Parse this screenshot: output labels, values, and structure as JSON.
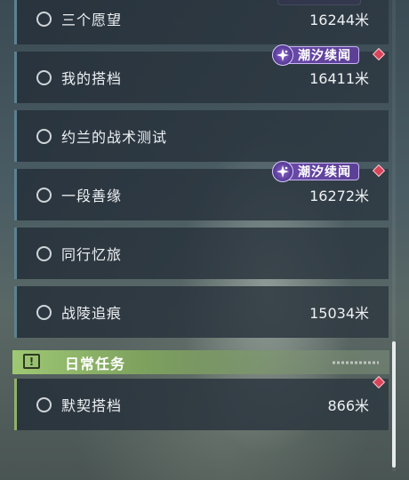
{
  "quests": [
    {
      "title": "三个愿望",
      "distance": "16244米"
    },
    {
      "title": "我的搭档",
      "distance": "16411米"
    },
    {
      "title": "约兰的战术测试",
      "distance": ""
    },
    {
      "title": "一段善缘",
      "distance": "16272米"
    },
    {
      "title": "同行忆旅",
      "distance": ""
    },
    {
      "title": "战陵追痕",
      "distance": "15034米"
    }
  ],
  "badges": [
    {
      "label": "潮汐续闻",
      "icon": "sparkle-icon",
      "color": "#6a4aa8"
    },
    {
      "label": "潮汐续闻",
      "icon": "sparkle-icon",
      "color": "#6a4aa8"
    }
  ],
  "daily_section": {
    "title": "日常任务",
    "icon": "exclamation-icon",
    "color": "#9fc874"
  },
  "daily_quests": [
    {
      "title": "默契搭档",
      "distance": "866米"
    }
  ],
  "tracked_marker_color": "#d9435a"
}
